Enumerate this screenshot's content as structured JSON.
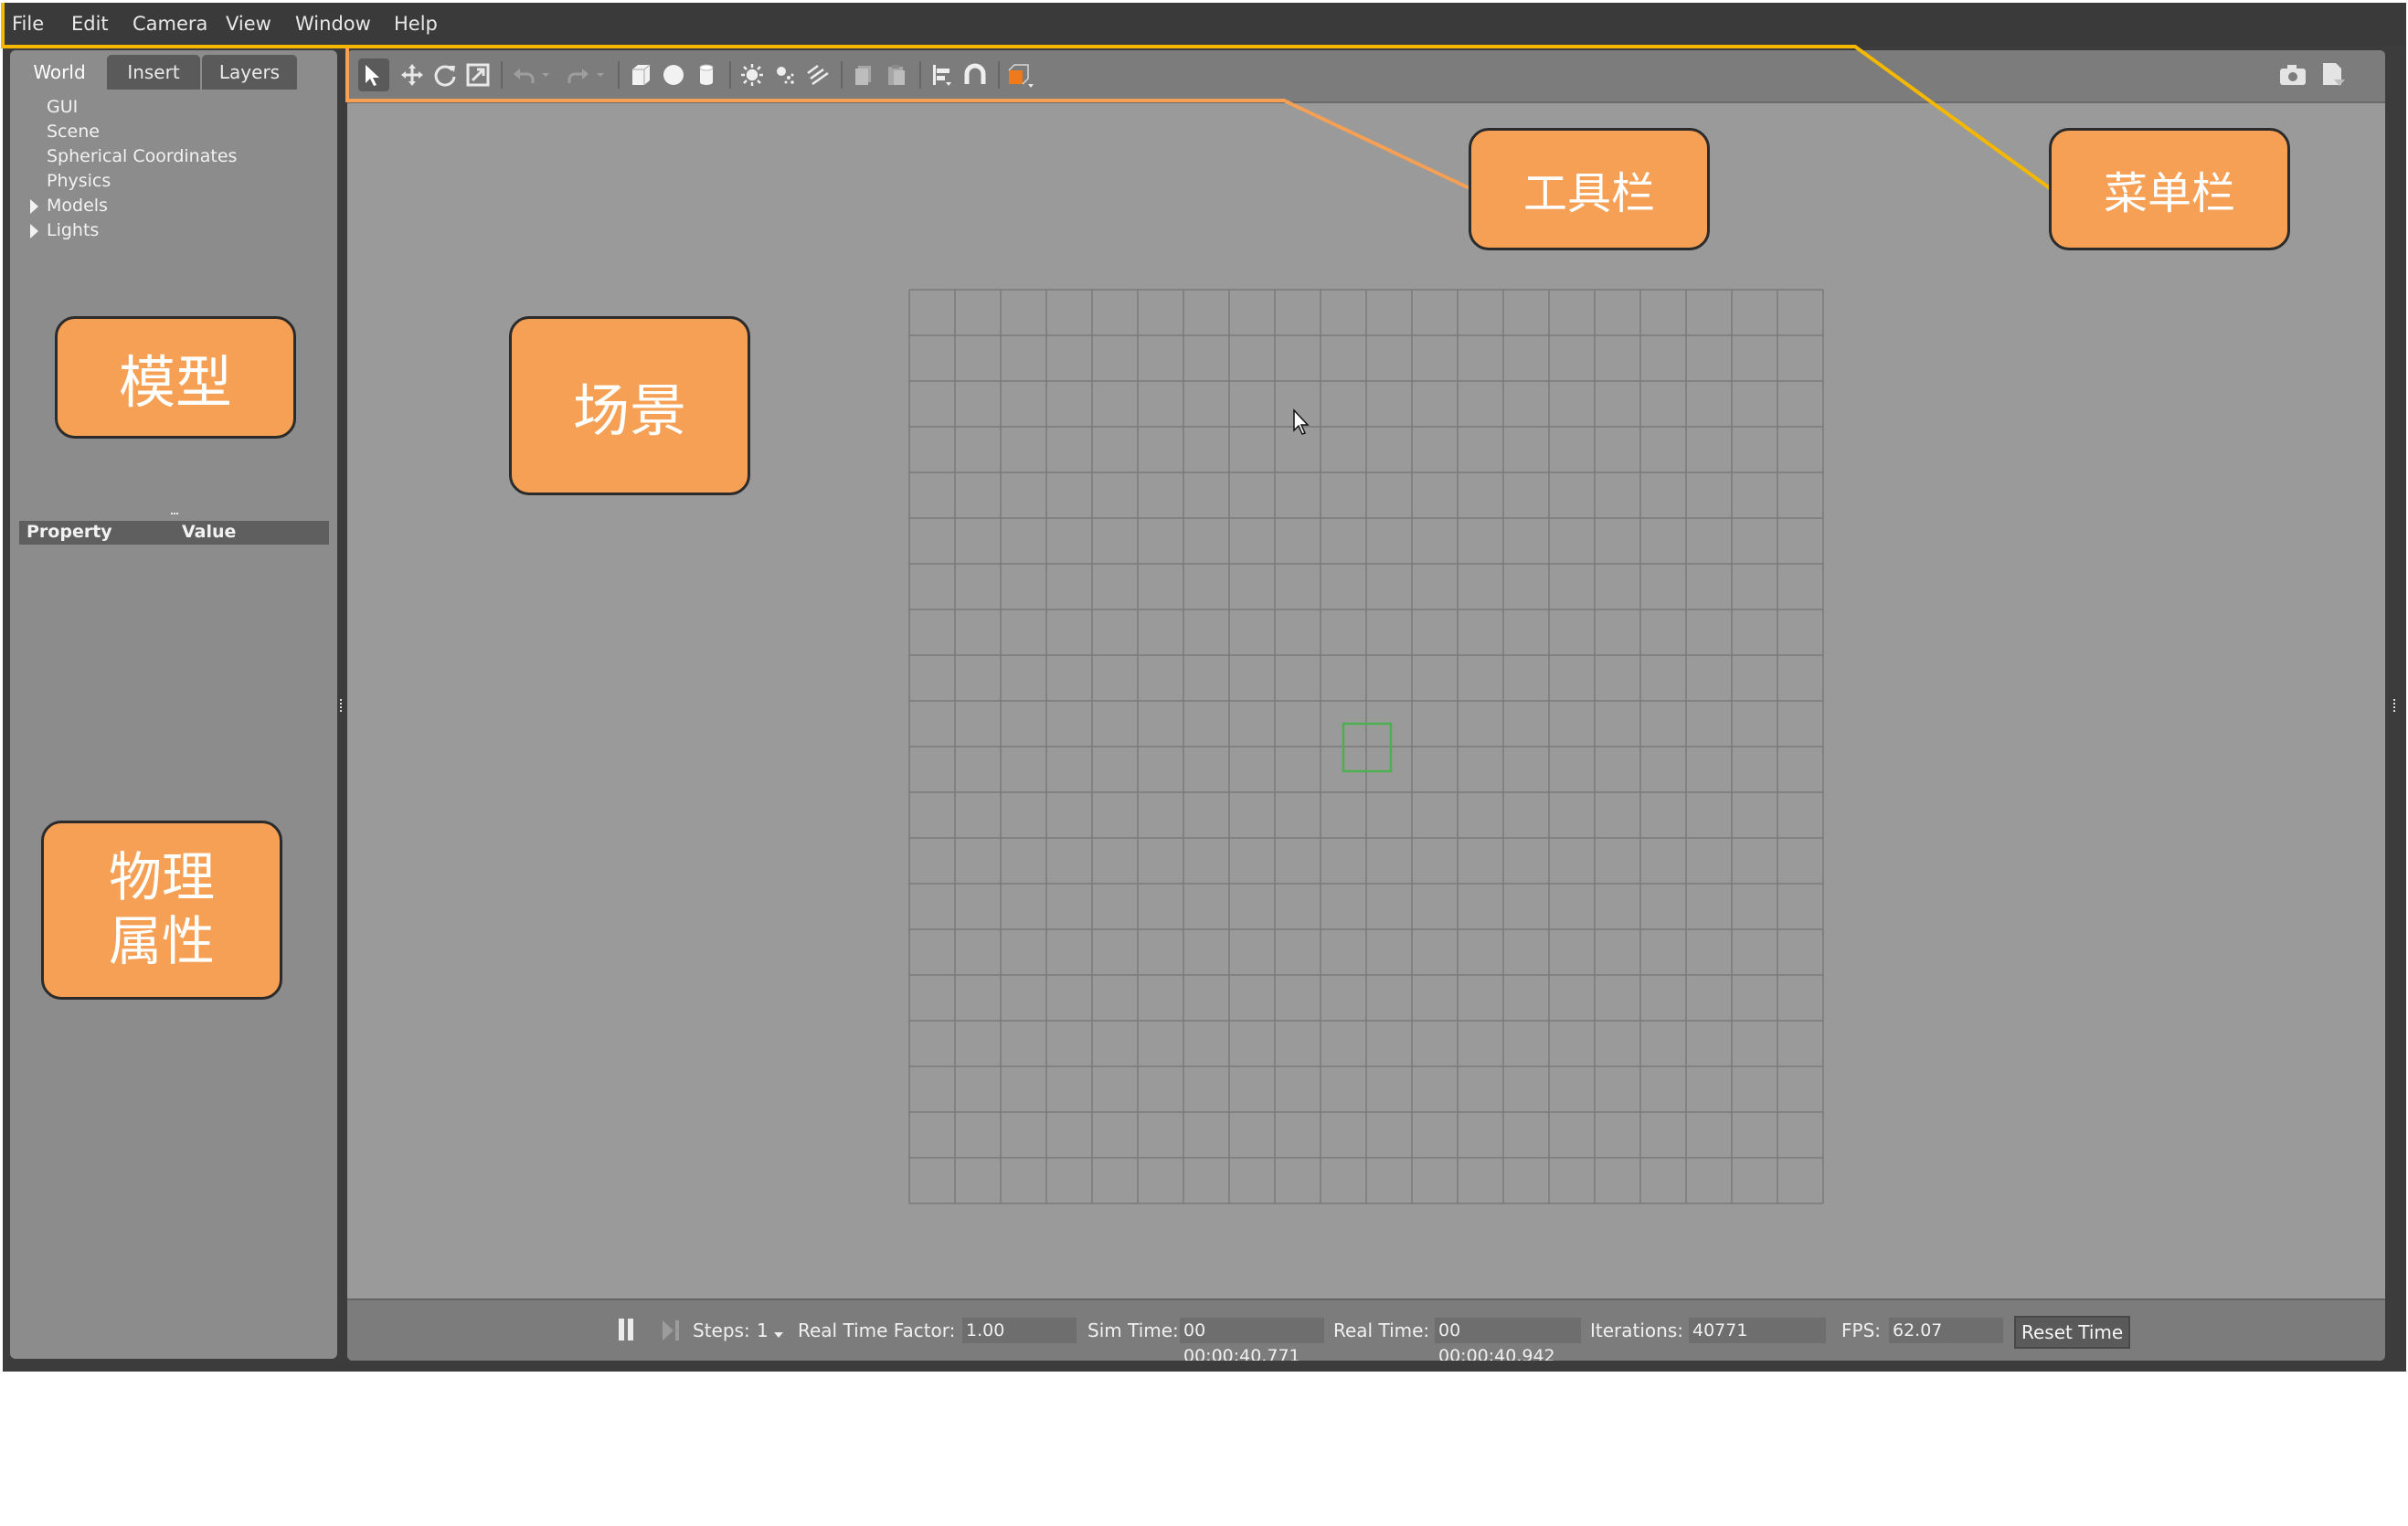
{
  "menubar": {
    "items": [
      "File",
      "Edit",
      "Camera",
      "View",
      "Window",
      "Help"
    ]
  },
  "left_panel": {
    "tabs": [
      "World",
      "Insert",
      "Layers"
    ],
    "tree": [
      "GUI",
      "Scene",
      "Spherical Coordinates",
      "Physics",
      "Models",
      "Lights"
    ],
    "property_header": {
      "property": "Property",
      "value": "Value"
    }
  },
  "toolbar": {
    "icons": [
      "select-arrow-icon",
      "translate-icon",
      "rotate-icon",
      "scale-icon",
      "undo-icon",
      "undo-dropdown-icon",
      "redo-icon",
      "redo-dropdown-icon",
      "box-icon",
      "sphere-icon",
      "cylinder-icon",
      "point-light-icon",
      "spot-light-icon",
      "directional-light-icon",
      "copy-icon",
      "paste-icon",
      "align-icon",
      "snap-icon",
      "view-angle-icon",
      "screenshot-icon",
      "log-icon"
    ]
  },
  "bottom_bar": {
    "steps_label": "Steps:",
    "steps_value": "1",
    "rtf_label": "Real Time Factor:",
    "rtf_value": "1.00",
    "sim_time_label": "Sim Time:",
    "sim_time_value": "00 00:00:40.771",
    "real_time_label": "Real Time:",
    "real_time_value": "00 00:00:40.942",
    "iterations_label": "Iterations:",
    "iterations_value": "40771",
    "fps_label": "FPS:",
    "fps_value": "62.07",
    "reset_label": "Reset Time"
  },
  "annotations": {
    "toolbar": "工具栏",
    "menubar": "菜单栏",
    "model": "模型",
    "scene": "场景",
    "physics_line1": "物理",
    "physics_line2": "属性"
  },
  "colors": {
    "callout_fill": "#f5a055",
    "menubar_highlight": "#f5b800",
    "toolbar_highlight": "#f5a055",
    "view_angle_orange": "#f07a1a",
    "origin_marker_green": "#4caf50"
  }
}
